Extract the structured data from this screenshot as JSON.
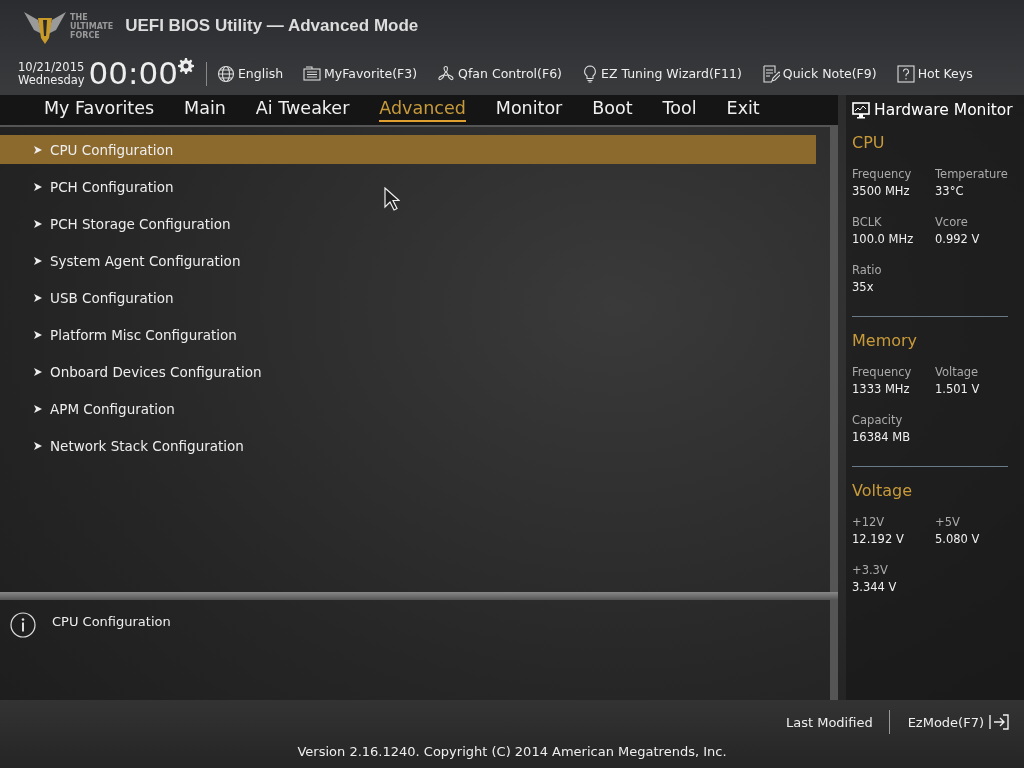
{
  "header": {
    "logo_text": [
      "THE",
      "ULTIMATE",
      "FORCE"
    ],
    "title": "UEFI BIOS Utility — Advanced Mode",
    "date": "10/21/2015",
    "weekday": "Wednesday",
    "time": "00:00",
    "toolbar": [
      {
        "kind": "globe",
        "label": "English"
      },
      {
        "kind": "favorite",
        "label": "MyFavorite(F3)"
      },
      {
        "kind": "fan",
        "label": "Qfan Control(F6)"
      },
      {
        "kind": "bulb",
        "label": "EZ Tuning Wizard(F11)"
      },
      {
        "kind": "note",
        "label": "Quick Note(F9)"
      },
      {
        "kind": "help",
        "label": "Hot Keys"
      }
    ]
  },
  "tabs": [
    {
      "label": "My Favorites",
      "selected": false
    },
    {
      "label": "Main",
      "selected": false
    },
    {
      "label": "Ai Tweaker",
      "selected": false
    },
    {
      "label": "Advanced",
      "selected": true
    },
    {
      "label": "Monitor",
      "selected": false
    },
    {
      "label": "Boot",
      "selected": false
    },
    {
      "label": "Tool",
      "selected": false
    },
    {
      "label": "Exit",
      "selected": false
    }
  ],
  "menu": [
    {
      "label": "CPU Configuration",
      "selected": true
    },
    {
      "label": "PCH Configuration",
      "selected": false
    },
    {
      "label": "PCH Storage Configuration",
      "selected": false
    },
    {
      "label": "System Agent Configuration",
      "selected": false
    },
    {
      "label": "USB Configuration",
      "selected": false
    },
    {
      "label": "Platform Misc Configuration",
      "selected": false
    },
    {
      "label": "Onboard Devices Configuration",
      "selected": false
    },
    {
      "label": "APM Configuration",
      "selected": false
    },
    {
      "label": "Network Stack Configuration",
      "selected": false
    }
  ],
  "help": {
    "text": "CPU Configuration"
  },
  "hardware_monitor": {
    "title": "Hardware Monitor",
    "sections": [
      {
        "title": "CPU",
        "items": [
          {
            "label": "Frequency",
            "value": "3500 MHz"
          },
          {
            "label": "Temperature",
            "value": "33°C"
          },
          {
            "label": "BCLK",
            "value": "100.0 MHz"
          },
          {
            "label": "Vcore",
            "value": "0.992 V"
          },
          {
            "label": "Ratio",
            "value": "35x"
          }
        ]
      },
      {
        "title": "Memory",
        "items": [
          {
            "label": "Frequency",
            "value": "1333 MHz"
          },
          {
            "label": "Voltage",
            "value": "1.501 V"
          },
          {
            "label": "Capacity",
            "value": "16384 MB"
          }
        ]
      },
      {
        "title": "Voltage",
        "items": [
          {
            "label": "+12V",
            "value": "12.192 V"
          },
          {
            "label": "+5V",
            "value": "5.080 V"
          },
          {
            "label": "+3.3V",
            "value": "3.344 V"
          }
        ]
      }
    ]
  },
  "footer": {
    "last_modified": "Last Modified",
    "ez_mode": "EzMode(F7)",
    "version": "Version 2.16.1240. Copyright (C) 2014 American Megatrends, Inc."
  }
}
